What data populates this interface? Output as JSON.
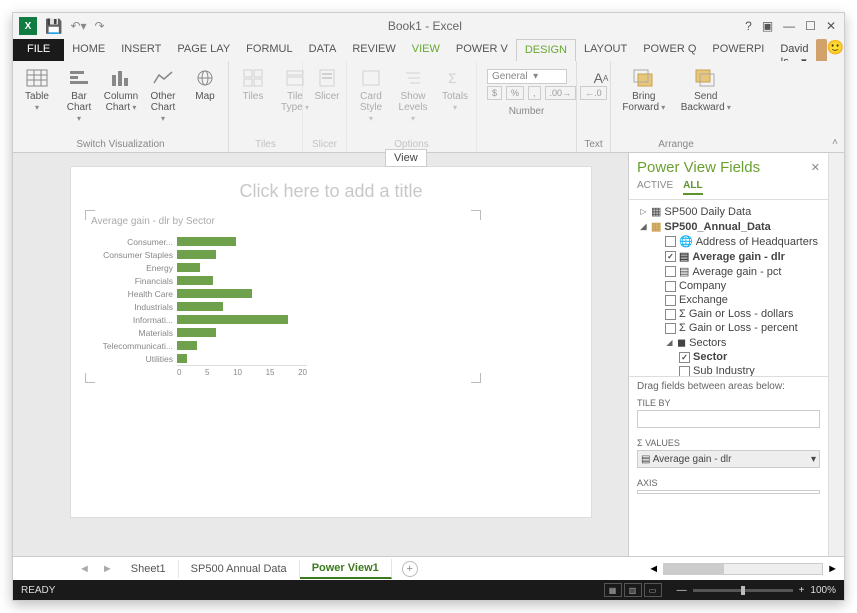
{
  "window": {
    "title": "Book1 - Excel",
    "user": "David Is..."
  },
  "tabs": [
    "HOME",
    "INSERT",
    "PAGE LAY",
    "FORMUL",
    "DATA",
    "REVIEW",
    "VIEW",
    "POWER V",
    "DESIGN",
    "LAYOUT",
    "POWER Q",
    "POWERPI"
  ],
  "active_tab": "DESIGN",
  "ribbon": {
    "switch": {
      "label": "Switch Visualization",
      "table": "Table",
      "bar": "Bar Chart",
      "column": "Column Chart",
      "other": "Other Chart",
      "map": "Map"
    },
    "tiles": {
      "label": "Tiles",
      "tiles": "Tiles",
      "tiletype": "Tile Type"
    },
    "slicer": {
      "label": "Slicer",
      "slicer": "Slicer"
    },
    "options": {
      "label": "Options",
      "cardstyle": "Card Style",
      "showlevels": "Show Levels",
      "totals": "Totals"
    },
    "number": {
      "label": "Number",
      "format": "General"
    },
    "text": {
      "label": "Text"
    },
    "arrange": {
      "label": "Arrange",
      "forward": "Bring Forward",
      "backward": "Send Backward"
    }
  },
  "tooltip": "View",
  "canvas": {
    "title_placeholder": "Click here to add a title",
    "chart_title": "Average gain - dlr by Sector"
  },
  "chart_data": {
    "type": "bar",
    "title": "Average gain - dlr by Sector",
    "xlabel": "",
    "ylabel": "",
    "xlim": [
      0,
      20
    ],
    "ticks": [
      0,
      5,
      10,
      15,
      20
    ],
    "categories": [
      "Consumer...",
      "Consumer Staples",
      "Energy",
      "Financials",
      "Health Care",
      "Industrials",
      "Informati...",
      "Materials",
      "Telecommunicati...",
      "Utilities"
    ],
    "values": [
      9,
      6,
      3.5,
      5.5,
      11.5,
      7,
      17,
      6,
      3,
      1.5
    ]
  },
  "fields": {
    "title": "Power View Fields",
    "tabs": [
      "ACTIVE",
      "ALL"
    ],
    "active": "ALL",
    "tables": [
      {
        "name": "SP500 Daily Data",
        "expanded": false
      },
      {
        "name": "SP500_Annual_Data",
        "expanded": true,
        "fields": [
          {
            "name": "Address of Headquarters",
            "checked": false,
            "icon": "globe"
          },
          {
            "name": "Average gain - dlr",
            "checked": true,
            "bold": true
          },
          {
            "name": "Average gain - pct",
            "checked": false
          },
          {
            "name": "Company",
            "checked": false
          },
          {
            "name": "Exchange",
            "checked": false
          },
          {
            "name": "Gain or Loss - dollars",
            "checked": false,
            "icon": "sigma"
          },
          {
            "name": "Gain or Loss - percent",
            "checked": false,
            "icon": "sigma"
          }
        ],
        "subgroup": {
          "name": "Sectors",
          "expanded": true,
          "fields": [
            {
              "name": "Sector",
              "checked": true
            },
            {
              "name": "Sub Industry",
              "checked": false
            }
          ]
        }
      }
    ],
    "drag_label": "Drag fields between areas below:",
    "zones": {
      "tileby": "TILE BY",
      "values": "Σ VALUES",
      "values_item": "Average gain - dlr",
      "axis": "AXIS"
    }
  },
  "sheets": [
    "Sheet1",
    "SP500 Annual Data",
    "Power View1"
  ],
  "active_sheet": "Power View1",
  "status": {
    "ready": "READY",
    "zoom": "100%"
  }
}
